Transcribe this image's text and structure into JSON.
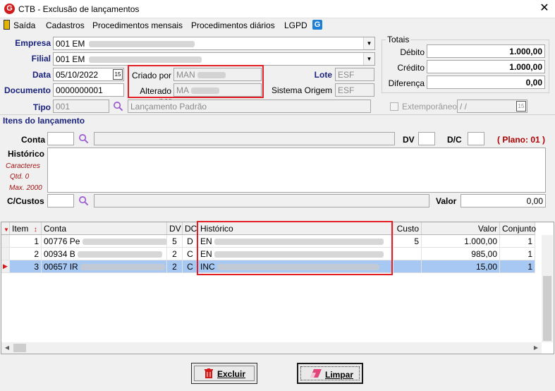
{
  "window": {
    "title": "CTB - Exclusão de lançamentos",
    "logo_letter": "G"
  },
  "menu": {
    "items": [
      "Saída",
      "Cadastros",
      "Procedimentos mensais",
      "Procedimentos diários",
      "LGPD"
    ]
  },
  "form": {
    "empresa_label": "Empresa",
    "empresa_value": "001 EM",
    "filial_label": "Filial",
    "filial_value": "001 EM",
    "data_label": "Data",
    "data_value": "05/10/2022",
    "documento_label": "Documento",
    "documento_value": "0000000001",
    "tipo_label": "Tipo",
    "tipo_code": "001",
    "tipo_desc": "Lançamento Padrão",
    "criado_label": "Criado por",
    "criado_value": "MAN",
    "alterado_label": "Alterado por",
    "alterado_value": "MA",
    "lote_label": "Lote",
    "lote_value": "ESF",
    "sistema_label": "Sistema Origem",
    "sistema_value": "ESF",
    "extemporaneo_label": "Extemporâneo",
    "extemporaneo_date": " / /"
  },
  "totais": {
    "title": "Totais",
    "debito_label": "Débito",
    "debito_value": "1.000,00",
    "credito_label": "Crédito",
    "credito_value": "1.000,00",
    "diferenca_label": "Diferença",
    "diferenca_value": "0,00"
  },
  "itens": {
    "section_title": "Itens do lançamento",
    "conta_label": "Conta",
    "dv_label": "DV",
    "dc_label": "D/C",
    "plano_text": "( Plano: 01 )",
    "historico_label": "Histórico",
    "caracteres_label": "Caracteres",
    "qtd_label": "Qtd. 0",
    "max_label": "Max. 2000",
    "ccustos_label": "C/Custos",
    "valor_label": "Valor",
    "valor_value": "0,00"
  },
  "grid": {
    "headers": {
      "item": "Item",
      "conta": "Conta",
      "dv": "DV",
      "dc": "DC",
      "historico": "Histórico",
      "custo": "Custo",
      "valor": "Valor",
      "conjunto": "Conjunto"
    },
    "rows": [
      {
        "item": "1",
        "conta": "00776 Pe",
        "dv": "5",
        "dc": "D",
        "historico": "EN",
        "custo": "5",
        "valor": "1.000,00",
        "conjunto": "1"
      },
      {
        "item": "2",
        "conta": "00934 B",
        "dv": "2",
        "dc": "C",
        "historico": "EN",
        "custo": "",
        "valor": "985,00",
        "conjunto": "1"
      },
      {
        "item": "3",
        "conta": "00657 IR",
        "dv": "2",
        "dc": "C",
        "historico": "INC",
        "custo": "",
        "valor": "15,00",
        "conjunto": "1"
      }
    ]
  },
  "buttons": {
    "excluir": "Excluir",
    "limpar": "Limpar"
  },
  "colors": {
    "accent_red": "#e31e24",
    "label_blue": "#1a237e",
    "plano_red": "#b00000",
    "selected_row": "#a6c8f2"
  }
}
